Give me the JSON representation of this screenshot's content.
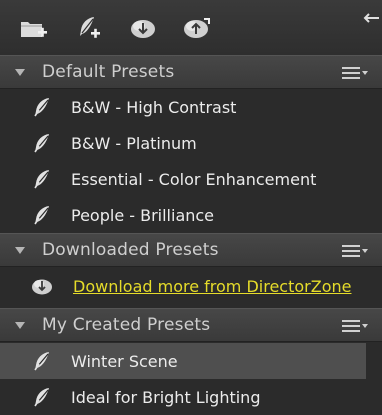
{
  "toolbar": {
    "icons": [
      "new-folder-icon",
      "new-preset-icon",
      "download-icon",
      "upload-icon"
    ],
    "collapse_icon": "collapse-arrow-icon"
  },
  "sections": [
    {
      "title": "Default Presets",
      "items": [
        {
          "label": "B&W - High Contrast",
          "icon": "feather-icon"
        },
        {
          "label": "B&W - Platinum",
          "icon": "feather-icon"
        },
        {
          "label": "Essential - Color Enhancement",
          "icon": "feather-icon"
        },
        {
          "label": "People - Brilliance",
          "icon": "feather-icon"
        }
      ]
    },
    {
      "title": "Downloaded Presets",
      "link": {
        "label": "Download more from DirectorZone",
        "icon": "download-cloud-icon"
      }
    },
    {
      "title": "My Created Presets",
      "items": [
        {
          "label": "Winter Scene",
          "icon": "feather-icon",
          "selected": true
        },
        {
          "label": "Ideal for Bright Lighting",
          "icon": "feather-icon"
        }
      ]
    }
  ],
  "colors": {
    "background": "#2b2b2b",
    "header": "#404040",
    "selected_row": "#4f4f4f",
    "link": "#e6dc2a"
  }
}
